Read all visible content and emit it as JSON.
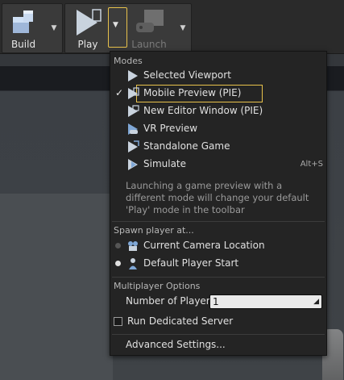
{
  "toolbar": {
    "build_label": "Build",
    "play_label": "Play",
    "launch_label": "Launch"
  },
  "menu": {
    "modes_header": "Modes",
    "modes": [
      {
        "label": "Selected Viewport",
        "icon": "play-icon",
        "checked": false,
        "shortcut": ""
      },
      {
        "label": "Mobile Preview (PIE)",
        "icon": "mobile-preview-icon",
        "checked": true,
        "shortcut": ""
      },
      {
        "label": "New Editor Window (PIE)",
        "icon": "new-window-icon",
        "checked": false,
        "shortcut": ""
      },
      {
        "label": "VR Preview",
        "icon": "vr-preview-icon",
        "checked": false,
        "shortcut": ""
      },
      {
        "label": "Standalone Game",
        "icon": "standalone-game-icon",
        "checked": false,
        "shortcut": ""
      },
      {
        "label": "Simulate",
        "icon": "simulate-icon",
        "checked": false,
        "shortcut": "Alt+S"
      }
    ],
    "check_mark": "✓",
    "description": "Launching a game preview with a different mode will change your default 'Play' mode in the toolbar",
    "spawn_header": "Spawn player at...",
    "spawn_options": [
      {
        "label": "Current Camera Location",
        "icon": "camera-location-icon",
        "selected": false
      },
      {
        "label": "Default Player Start",
        "icon": "player-start-icon",
        "selected": true
      }
    ],
    "multiplayer_header": "Multiplayer Options",
    "num_players_label": "Number of Players",
    "num_players_value": "1",
    "dedicated_server_label": "Run Dedicated Server",
    "dedicated_server_checked": false,
    "advanced_label": "Advanced Settings..."
  },
  "colors": {
    "accent": "#e8c24b",
    "menu_bg": "#242424",
    "play_icon": "#c9d3de"
  }
}
